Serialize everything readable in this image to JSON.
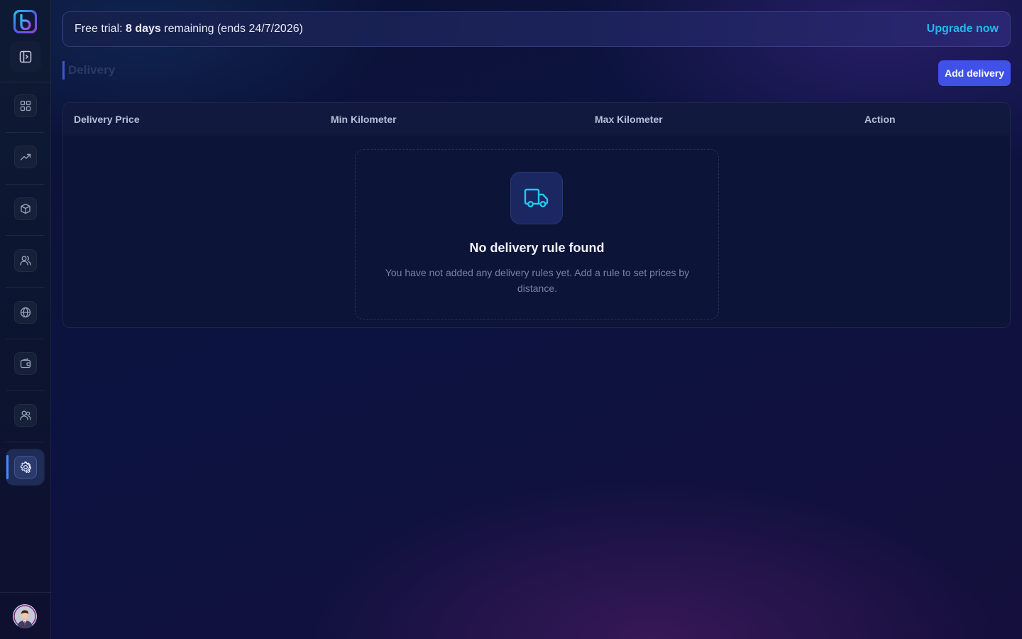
{
  "trial_banner": {
    "prefix": "Free trial: ",
    "days": "8 days",
    "suffix": " remaining (ends 24/7/2026)",
    "upgrade_label": "Upgrade now"
  },
  "page": {
    "title": "Delivery",
    "add_button_label": "Add delivery"
  },
  "table": {
    "columns": [
      "Delivery Price",
      "Min Kilometer",
      "Max Kilometer",
      "Action"
    ],
    "rows": []
  },
  "empty_state": {
    "icon": "truck-icon",
    "title": "No delivery rule found",
    "description": "You have not added any delivery rules yet. Add a rule to set prices by distance."
  },
  "sidebar": {
    "items": [
      {
        "icon": "dashboard-grid-icon"
      },
      {
        "icon": "trending-up-icon"
      },
      {
        "icon": "box-icon"
      },
      {
        "icon": "users-icon"
      },
      {
        "icon": "globe-icon"
      },
      {
        "icon": "wallet-icon"
      },
      {
        "icon": "team-icon"
      },
      {
        "icon": "settings-gear-icon",
        "active": true
      }
    ]
  },
  "colors": {
    "accent": "#3f51e6",
    "link": "#22b8ee",
    "active_indicator": "#3d8dff"
  }
}
